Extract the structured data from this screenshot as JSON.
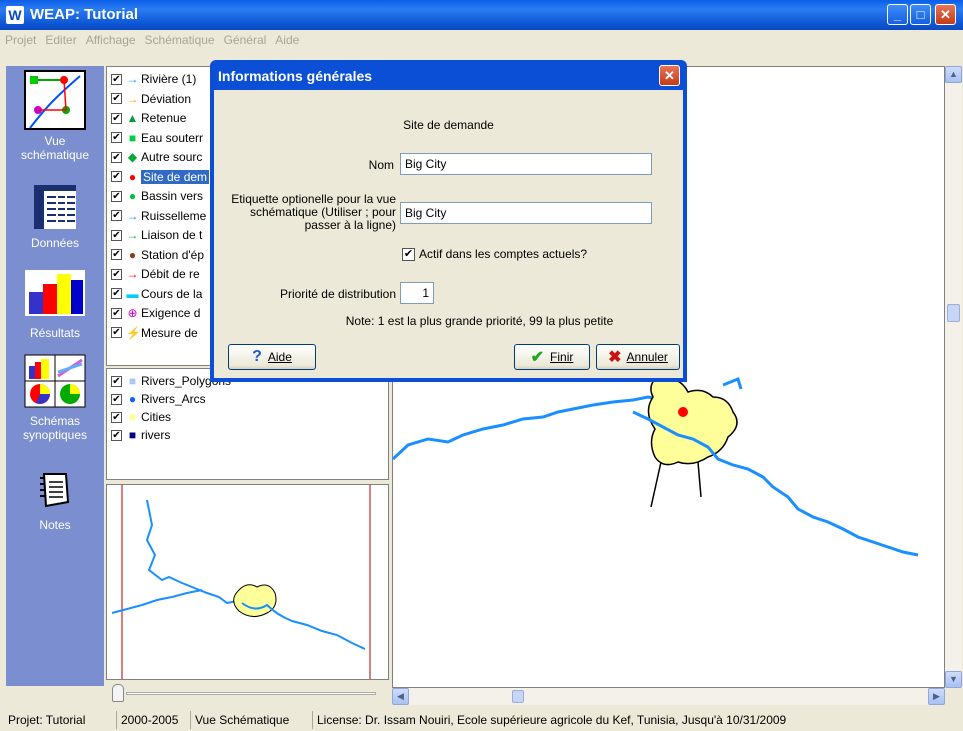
{
  "window": {
    "title": "WEAP: Tutorial",
    "app_icon": "W",
    "minimize": "_",
    "maximize": "□",
    "close": "✕"
  },
  "menu": [
    "Projet",
    "Editer",
    "Affichage",
    "Schématique",
    "Général",
    "Aide"
  ],
  "nav": {
    "items": [
      {
        "label": "Vue\nschématique",
        "icon": "schematic-icon"
      },
      {
        "label": "Données",
        "icon": "data-table-icon"
      },
      {
        "label": "Résultats",
        "icon": "bar-chart-icon"
      },
      {
        "label": "Schémas\nsynoptiques",
        "icon": "overview-charts-icon"
      },
      {
        "label": "Notes",
        "icon": "notepad-icon"
      }
    ]
  },
  "layers": [
    {
      "label": "Rivière (1)",
      "symbol": "→",
      "color": "#00a0ff"
    },
    {
      "label": "Déviation",
      "symbol": "→",
      "color": "#ff9900"
    },
    {
      "label": "Retenue",
      "symbol": "▲",
      "color": "#00a040"
    },
    {
      "label": "Eau souterr",
      "symbol": "■",
      "color": "#00cc44"
    },
    {
      "label": "Autre sourc",
      "symbol": "◆",
      "color": "#00aa33"
    },
    {
      "label": "Site de dem",
      "symbol": "●",
      "color": "#ff0000",
      "selected": true
    },
    {
      "label": "Bassin vers",
      "symbol": "●",
      "color": "#00bb44"
    },
    {
      "label": "Ruisselleme",
      "symbol": "→",
      "color": "#00a0ff"
    },
    {
      "label": "Liaison de t",
      "symbol": "→",
      "color": "#00bb44"
    },
    {
      "label": "Station d'ép",
      "symbol": "●",
      "color": "#8b3a1a"
    },
    {
      "label": "Débit de re",
      "symbol": "→",
      "color": "#ff0000"
    },
    {
      "label": "Cours de la",
      "symbol": "▬",
      "color": "#00ccff"
    },
    {
      "label": "Exigence d",
      "symbol": "⊕",
      "color": "#cc00cc"
    },
    {
      "label": "Mesure de",
      "symbol": "⚡",
      "color": "#3333cc"
    }
  ],
  "gis_layers": [
    {
      "label": "Rivers_Polygons",
      "symbol": "■",
      "color": "#aac8f0"
    },
    {
      "label": "Rivers_Arcs",
      "symbol": "●",
      "color": "#1060ff"
    },
    {
      "label": "Cities",
      "symbol": "■",
      "color": "#ffff99"
    },
    {
      "label": "rivers",
      "symbol": "■",
      "color": "#000080"
    }
  ],
  "dialog": {
    "title": "Informations générales",
    "heading": "Site de demande",
    "name_label": "Nom",
    "name_value": "Big City",
    "tag_label": "Etiquette optionelle pour la vue schématique (Utiliser ; pour passer à la ligne)",
    "tag_value": "Big City",
    "active_label": "Actif dans les comptes actuels?",
    "active_checked": true,
    "priority_label": "Priorité de distribution",
    "priority_value": "1",
    "note": "Note: 1 est la plus grande priorité, 99 la plus petite",
    "help_button": "Aide",
    "finish_button": "Finir",
    "cancel_button": "Annuler"
  },
  "status": {
    "project": "Projet: Tutorial",
    "years": "2000-2005",
    "view": "Vue Schématique",
    "license": "License: Dr. Issam Nouiri, Ecole supérieure agricole du Kef, Tunisia, Jusqu'à 10/31/2009"
  }
}
